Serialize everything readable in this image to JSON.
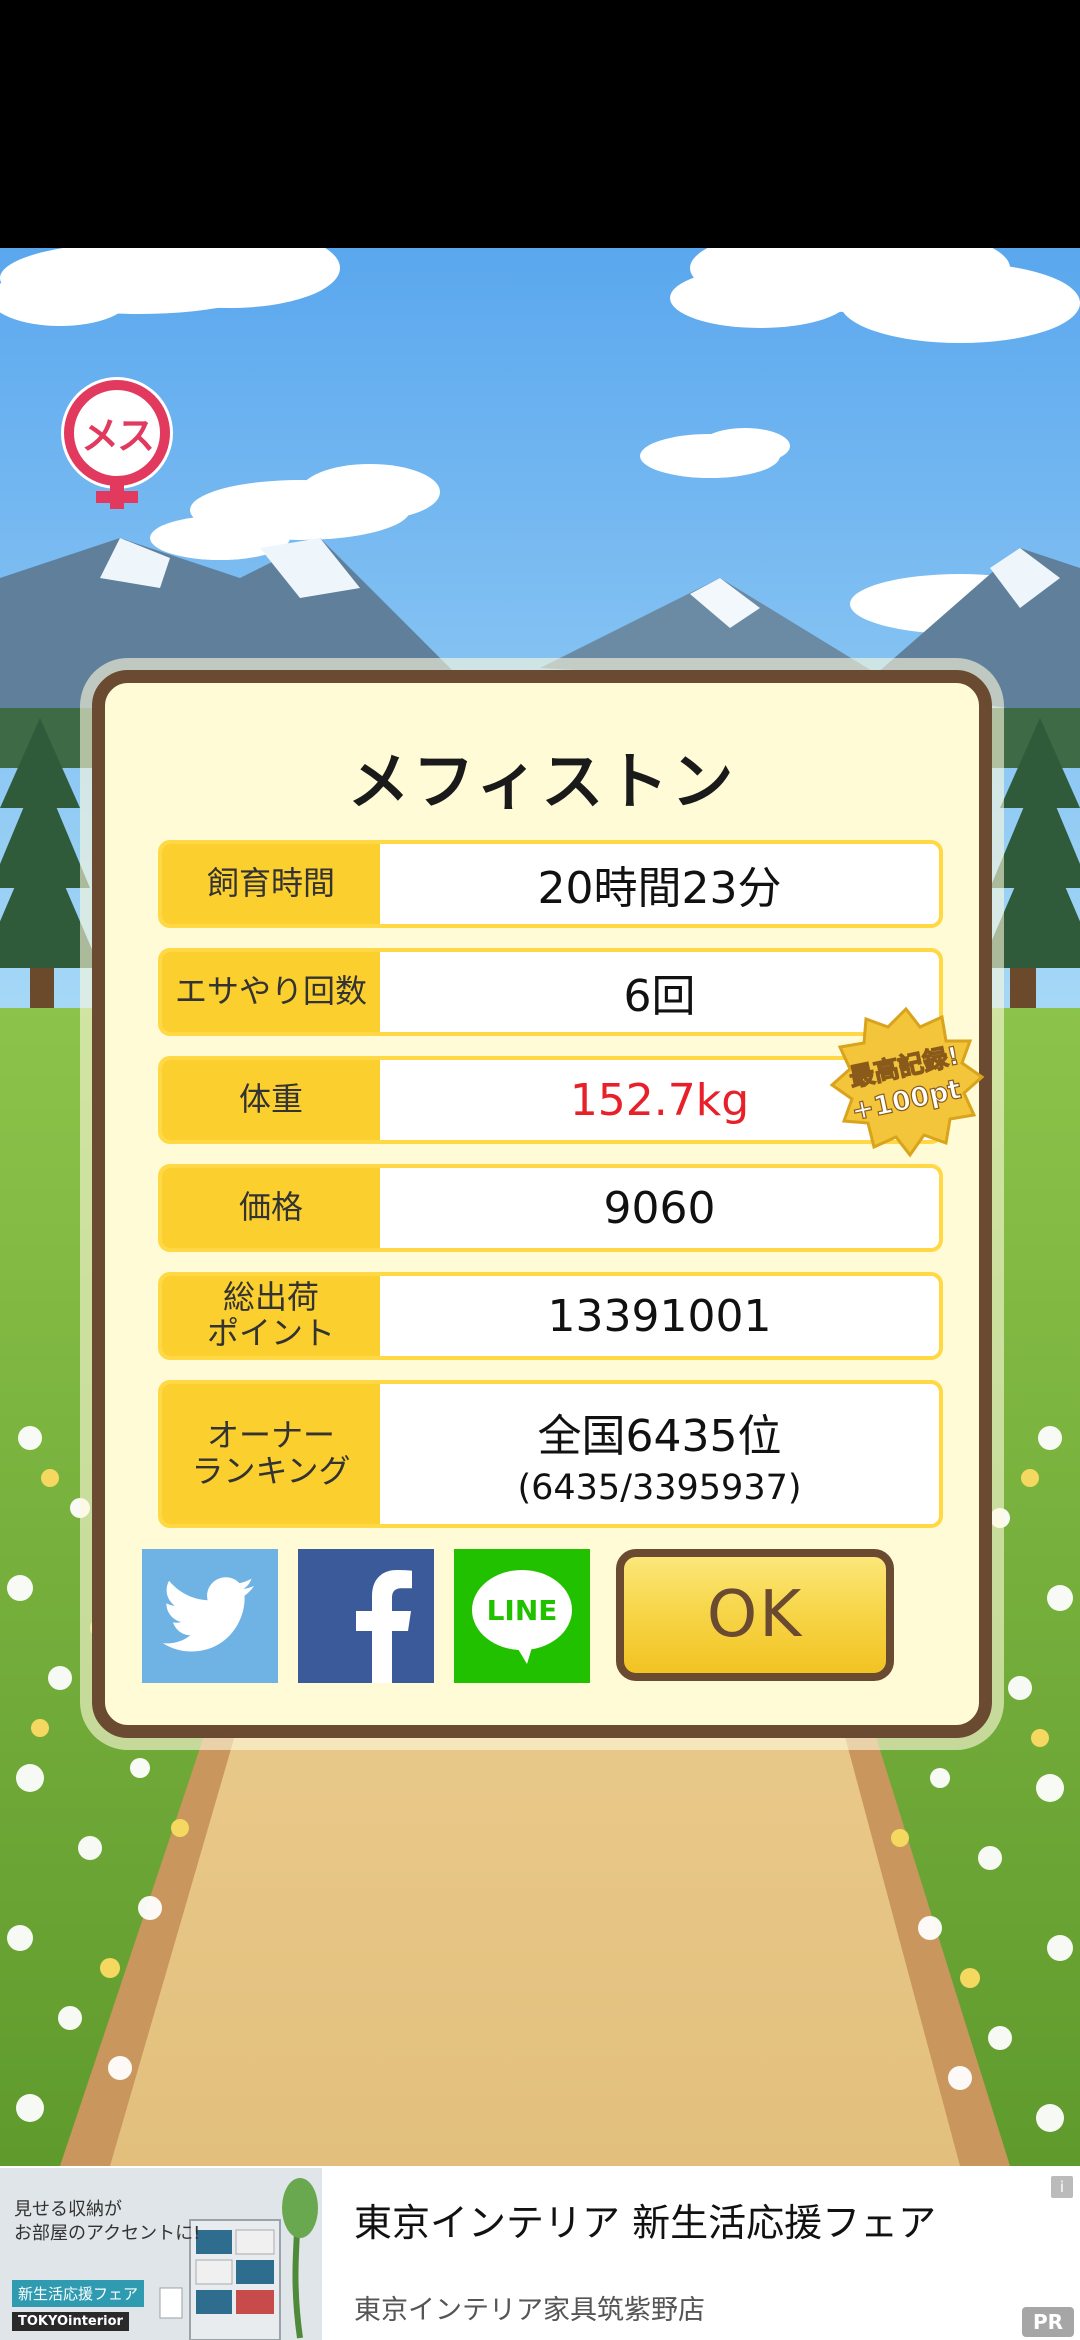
{
  "pig": {
    "name": "メフィストン",
    "sex_label": "メス"
  },
  "stats": {
    "breeding_time": {
      "label": "飼育時間",
      "value": "20時間23分"
    },
    "feeding_count": {
      "label": "エサやり回数",
      "value": "6回"
    },
    "weight": {
      "label": "体重",
      "value": "152.7kg"
    },
    "price": {
      "label": "価格",
      "value": "9060"
    },
    "total_points": {
      "label_line1": "総出荷",
      "label_line2": "ポイント",
      "value": "13391001"
    },
    "owner_ranking": {
      "label_line1": "オーナー",
      "label_line2": "ランキング",
      "value": "全国6435位",
      "detail": "(6435/3395937)"
    }
  },
  "record_badge": {
    "line1": "最高記録!",
    "line2": "+100pt"
  },
  "buttons": {
    "twitter_icon": "twitter-bird-icon",
    "facebook_icon": "facebook-f-icon",
    "line_icon": "line-bubble-icon",
    "line_text": "LINE",
    "ok_label": "OK"
  },
  "ad": {
    "image_caption": "見せる収納が\nお部屋のアクセントに!",
    "image_tag": "新生活応援フェア",
    "image_brand": "TOKYOinterior",
    "title": "東京インテリア 新生活応援フェア",
    "subtitle": "東京インテリア家具筑紫野店",
    "info_icon": "i",
    "pr_badge": "PR"
  },
  "colors": {
    "dialog_bg": "#fffbd6",
    "dialog_border": "#6a4a30",
    "label_bg": "#fbcf2d",
    "record_red": "#e8202a",
    "sex_badge": "#e23a5e"
  }
}
